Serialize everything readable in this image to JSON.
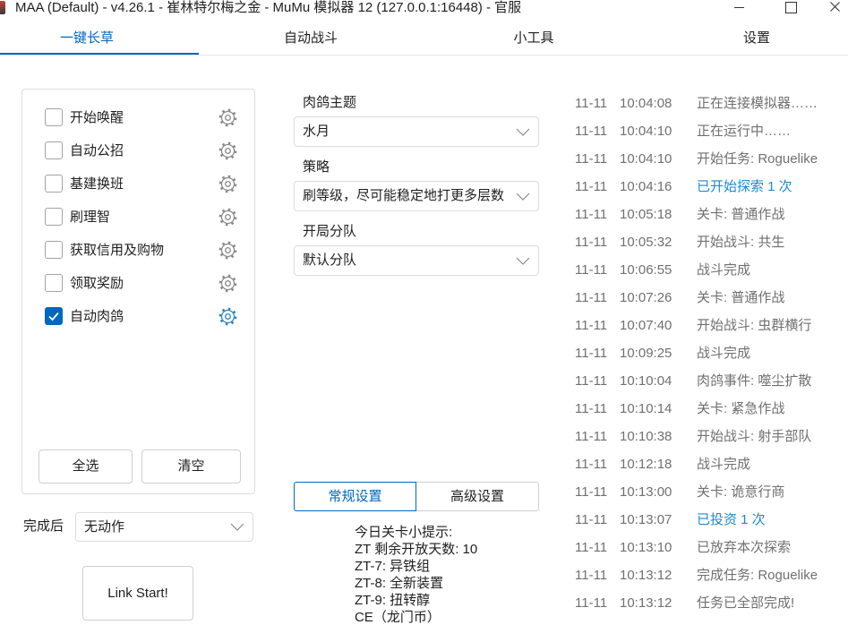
{
  "window": {
    "title": "MAA (Default) - v4.26.1 - 崔林特尔梅之金 - MuMu 模拟器 12 (127.0.0.1:16448) - 官服",
    "app_icon": "app-icon",
    "controls": {
      "minimize": "minimize-icon",
      "maximize": "maximize-icon",
      "close": "close-icon"
    }
  },
  "tabs": [
    {
      "label": "一键长草",
      "selected": true
    },
    {
      "label": "自动战斗",
      "selected": false
    },
    {
      "label": "小工具",
      "selected": false
    },
    {
      "label": "设置",
      "selected": false
    }
  ],
  "tasks": {
    "items": [
      {
        "label": "开始唤醒",
        "checked": false
      },
      {
        "label": "自动公招",
        "checked": false
      },
      {
        "label": "基建换班",
        "checked": false
      },
      {
        "label": "刷理智",
        "checked": false
      },
      {
        "label": "获取信用及购物",
        "checked": false
      },
      {
        "label": "领取奖励",
        "checked": false
      },
      {
        "label": "自动肉鸽",
        "checked": true
      }
    ],
    "settings_icon": "gear-icon",
    "select_all_label": "全选",
    "clear_label": "清空"
  },
  "after_completion": {
    "label": "完成后",
    "value": "无动作"
  },
  "link_start_label": "Link Start!",
  "roguelike": {
    "theme": {
      "label": "肉鸽主题",
      "value": "水月"
    },
    "strategy": {
      "label": "策略",
      "value": "刷等级，尽可能稳定地打更多层数"
    },
    "squad": {
      "label": "开局分队",
      "value": "默认分队"
    },
    "dropdown_icon": "chevron-down-icon",
    "settings_tabs": [
      {
        "label": "常规设置",
        "selected": true
      },
      {
        "label": "高级设置",
        "selected": false
      }
    ]
  },
  "stage_tips": {
    "heading": "今日关卡小提示:",
    "lines": [
      "ZT 剩余开放天数: 10",
      "ZT-7: 异铁组",
      "ZT-8: 全新装置",
      "ZT-9: 扭转醇",
      "CE（龙门币）"
    ]
  },
  "log": [
    {
      "date": "11-11",
      "time": "10:04:08",
      "message": "正在连接模拟器……",
      "highlight": false
    },
    {
      "date": "11-11",
      "time": "10:04:10",
      "message": "正在运行中……",
      "highlight": false
    },
    {
      "date": "11-11",
      "time": "10:04:10",
      "message": "开始任务: Roguelike",
      "highlight": false
    },
    {
      "date": "11-11",
      "time": "10:04:16",
      "message": "已开始探索 1 次",
      "highlight": true
    },
    {
      "date": "11-11",
      "time": "10:05:18",
      "message": "关卡: 普通作战",
      "highlight": false
    },
    {
      "date": "11-11",
      "time": "10:05:32",
      "message": "开始战斗: 共生",
      "highlight": false
    },
    {
      "date": "11-11",
      "time": "10:06:55",
      "message": "战斗完成",
      "highlight": false
    },
    {
      "date": "11-11",
      "time": "10:07:26",
      "message": "关卡: 普通作战",
      "highlight": false
    },
    {
      "date": "11-11",
      "time": "10:07:40",
      "message": "开始战斗: 虫群横行",
      "highlight": false
    },
    {
      "date": "11-11",
      "time": "10:09:25",
      "message": "战斗完成",
      "highlight": false
    },
    {
      "date": "11-11",
      "time": "10:10:04",
      "message": "肉鸽事件: 噬尘扩散",
      "highlight": false
    },
    {
      "date": "11-11",
      "time": "10:10:14",
      "message": "关卡: 紧急作战",
      "highlight": false
    },
    {
      "date": "11-11",
      "time": "10:10:38",
      "message": "开始战斗: 射手部队",
      "highlight": false
    },
    {
      "date": "11-11",
      "time": "10:12:18",
      "message": "战斗完成",
      "highlight": false
    },
    {
      "date": "11-11",
      "time": "10:13:00",
      "message": "关卡: 诡意行商",
      "highlight": false
    },
    {
      "date": "11-11",
      "time": "10:13:07",
      "message": "已投资 1 次",
      "highlight": true
    },
    {
      "date": "11-11",
      "time": "10:13:10",
      "message": "已放弃本次探索",
      "highlight": false
    },
    {
      "date": "11-11",
      "time": "10:13:12",
      "message": "完成任务: Roguelike",
      "highlight": false
    },
    {
      "date": "11-11",
      "time": "10:13:12",
      "message": "任务已全部完成!",
      "highlight": false
    }
  ],
  "colors": {
    "accent": "#0067c0",
    "log_text": "#707070",
    "log_highlight": "#1e88d0",
    "text": "#1f1f1f"
  }
}
